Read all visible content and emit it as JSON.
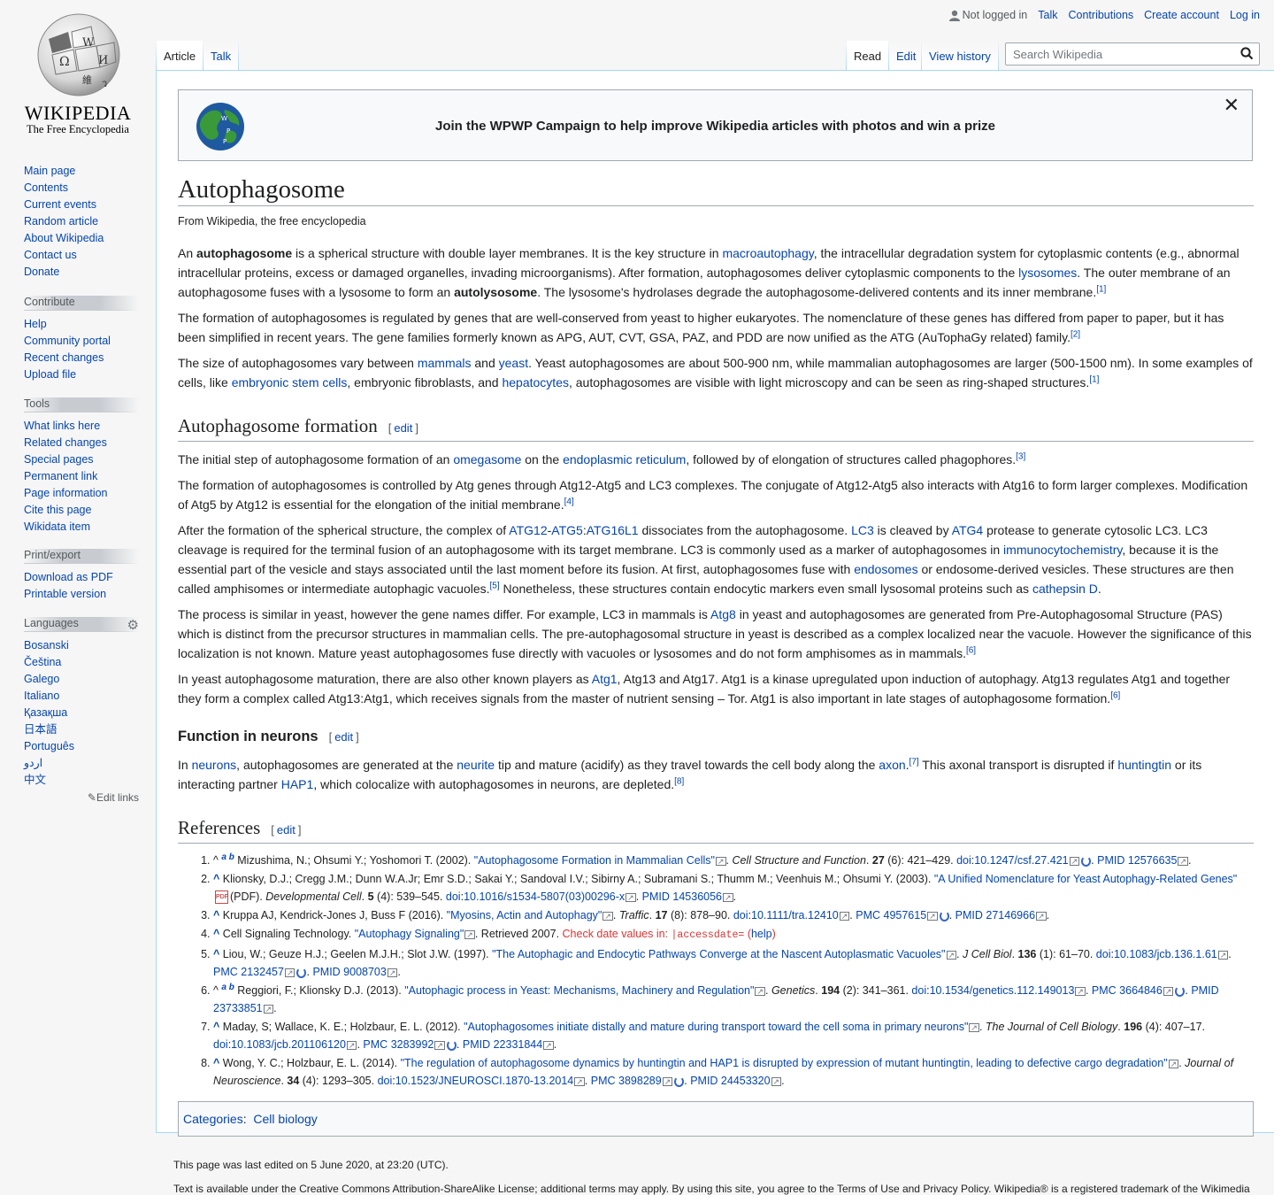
{
  "logo": {
    "wordmark": "WIKIPEDIA",
    "tagline": "The Free Encyclopedia"
  },
  "personal": {
    "not_logged_in": "Not logged in",
    "talk": "Talk",
    "contributions": "Contributions",
    "create_account": "Create account",
    "login": "Log in"
  },
  "tabs": {
    "article": "Article",
    "talk": "Talk",
    "read": "Read",
    "edit": "Edit",
    "history": "View history"
  },
  "search": {
    "placeholder": "Search Wikipedia"
  },
  "nav": {
    "items": [
      "Main page",
      "Contents",
      "Current events",
      "Random article",
      "About Wikipedia",
      "Contact us",
      "Donate"
    ]
  },
  "contribute": {
    "heading": "Contribute",
    "items": [
      "Help",
      "Community portal",
      "Recent changes",
      "Upload file"
    ]
  },
  "tools": {
    "heading": "Tools",
    "items": [
      "What links here",
      "Related changes",
      "Special pages",
      "Permanent link",
      "Page information",
      "Cite this page",
      "Wikidata item"
    ]
  },
  "print": {
    "heading": "Print/export",
    "items": [
      "Download as PDF",
      "Printable version"
    ]
  },
  "languages": {
    "heading": "Languages",
    "items": [
      "Bosanski",
      "Čeština",
      "Galego",
      "Italiano",
      "Қазақша",
      "日本語",
      "Português",
      "اردو",
      "中文"
    ],
    "edit_links": "Edit links"
  },
  "banner": {
    "text": "Join the WPWP Campaign to help improve Wikipedia articles with photos and win a prize",
    "close": "✕"
  },
  "article": {
    "title": "Autophagosome",
    "site_sub": "From Wikipedia, the free encyclopedia",
    "edit": "edit",
    "sec_formation": "Autophagosome formation",
    "sec_neurons": "Function in neurons",
    "sec_refs": "References"
  },
  "categories": {
    "label": "Categories",
    "items": [
      "Cell biology"
    ]
  },
  "footer": {
    "last_edited": "This page was last edited on 5 June 2020, at 23:20 (UTC).",
    "license": "Text is available under the Creative Commons Attribution-ShareAlike License; additional terms may apply. By using this site, you agree to the Terms of Use and Privacy Policy. Wikipedia® is a registered trademark of the Wikimedia"
  },
  "colors": {
    "link": "#0645ad",
    "redlink": "#d33",
    "border": "#a7d7f9"
  }
}
